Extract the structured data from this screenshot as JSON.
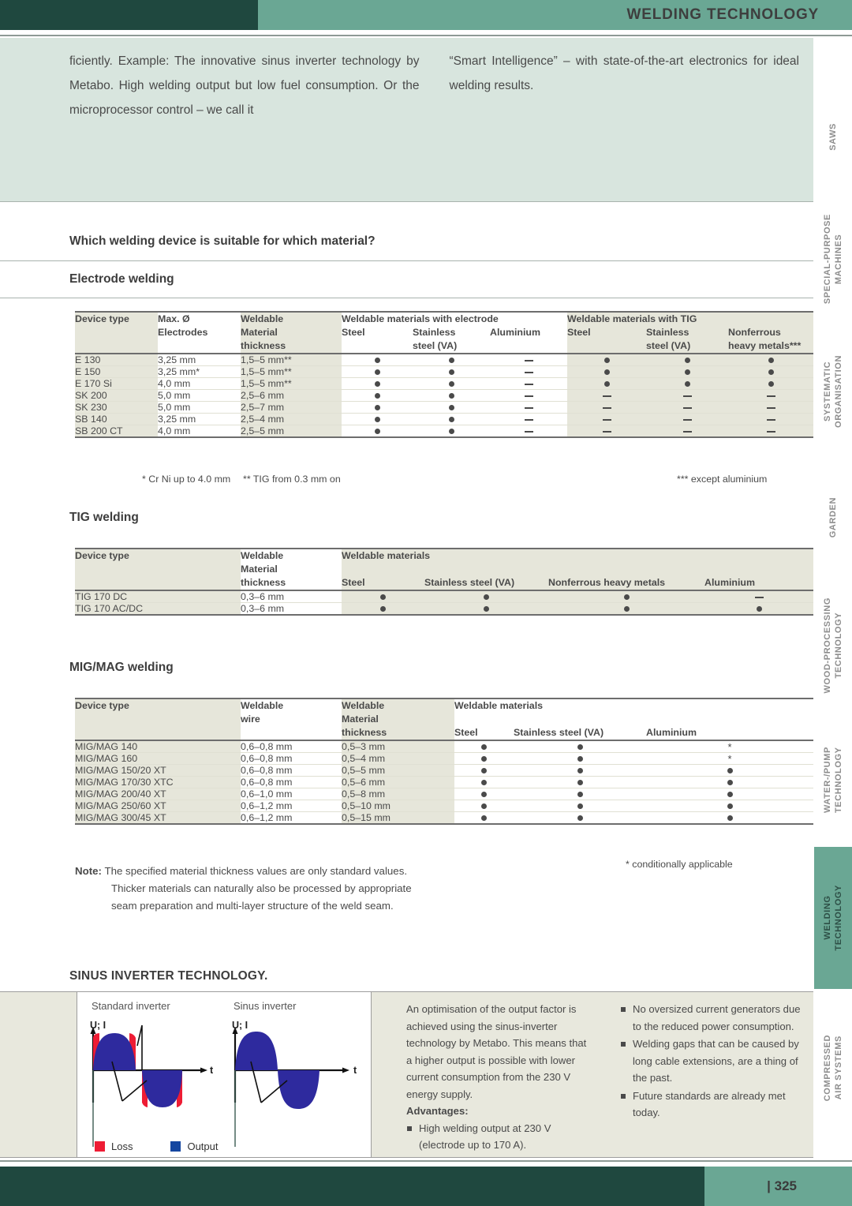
{
  "header": {
    "title": "WELDING TECHNOLOGY"
  },
  "intro": {
    "left": "ficiently. Example: The innovative sinus inverter techno­logy by Metabo. High welding output but low fuel con­sumption. Or the microprocessor control – we call it",
    "right": "“Smart Intelligence” – with state-of-the-art electronics for ideal welding results."
  },
  "question_heading": "Which welding device is suitable for which material?",
  "electrode": {
    "heading": "Electrode welding",
    "headers": {
      "device_type": "Device type",
      "max_dia": [
        "Max. Ø",
        "Electrodes"
      ],
      "thickness": [
        "Weldable",
        "Material",
        "thickness"
      ],
      "group_electrode": "Weldable materials with electrode",
      "group_tig": "Weldable materials  with TIG",
      "sub_electrode": [
        "Steel",
        "Stainless\nsteel (VA)",
        "Aluminium"
      ],
      "sub_tig": [
        "Steel",
        "Stainless\nsteel (VA)",
        "Nonferrous\nheavy metals***"
      ]
    },
    "rows": [
      {
        "device": "E 130",
        "dia": "3,25 mm",
        "thick": "1,5–5 mm**",
        "e": [
          "dot",
          "dot",
          "dash"
        ],
        "t": [
          "dot",
          "dot",
          "dot"
        ]
      },
      {
        "device": "E 150",
        "dia": "3,25 mm*",
        "thick": "1,5–5 mm**",
        "e": [
          "dot",
          "dot",
          "dash"
        ],
        "t": [
          "dot",
          "dot",
          "dot"
        ]
      },
      {
        "device": "E 170 Si",
        "dia": "4,0 mm",
        "thick": "1,5–5 mm**",
        "e": [
          "dot",
          "dot",
          "dash"
        ],
        "t": [
          "dot",
          "dot",
          "dot"
        ]
      },
      {
        "device": "SK 200",
        "dia": "5,0 mm",
        "thick": "2,5–6 mm",
        "e": [
          "dot",
          "dot",
          "dash"
        ],
        "t": [
          "dash",
          "dash",
          "dash"
        ]
      },
      {
        "device": "SK 230",
        "dia": "5,0 mm",
        "thick": "2,5–7 mm",
        "e": [
          "dot",
          "dot",
          "dash"
        ],
        "t": [
          "dash",
          "dash",
          "dash"
        ]
      },
      {
        "device": "SB 140",
        "dia": "3,25 mm",
        "thick": "2,5–4 mm",
        "e": [
          "dot",
          "dot",
          "dash"
        ],
        "t": [
          "dash",
          "dash",
          "dash"
        ]
      },
      {
        "device": "SB 200 CT",
        "dia": "4,0 mm",
        "thick": "2,5–5 mm",
        "e": [
          "dot",
          "dot",
          "dash"
        ],
        "t": [
          "dash",
          "dash",
          "dash"
        ]
      }
    ],
    "footnotes": {
      "one": "* Cr Ni up to 4.0 mm",
      "two": "** TIG from 0.3 mm on",
      "three": "*** except aluminium"
    }
  },
  "tig": {
    "heading": "TIG welding",
    "headers": {
      "device_type": "Device type",
      "thickness": [
        "Weldable",
        "Material",
        "thickness"
      ],
      "group": "Weldable materials",
      "sub": [
        "Steel",
        "Stainless steel (VA)",
        "Nonferrous heavy metals",
        "Aluminium"
      ]
    },
    "rows": [
      {
        "device": "TIG 170 DC",
        "thick": "0,3–6 mm",
        "m": [
          "dot",
          "dot",
          "dot",
          "dash"
        ]
      },
      {
        "device": "TIG 170 AC/DC",
        "thick": "0,3–6 mm",
        "m": [
          "dot",
          "dot",
          "dot",
          "dot"
        ]
      }
    ]
  },
  "migmag": {
    "heading": "MIG/MAG welding",
    "headers": {
      "device_type": "Device type",
      "wire": [
        "Weldable",
        "wire"
      ],
      "thickness": [
        "Weldable",
        "Material",
        "thickness"
      ],
      "group": "Weldable materials",
      "sub": [
        "Steel",
        "Stainless steel (VA)",
        "Aluminium"
      ]
    },
    "rows": [
      {
        "device": "MIG/MAG 140",
        "wire": "0,6–0,8 mm",
        "thick": "0,5–3 mm",
        "m": [
          "dot",
          "dot",
          "ast"
        ]
      },
      {
        "device": "MIG/MAG 160",
        "wire": "0,6–0,8 mm",
        "thick": "0,5–4 mm",
        "m": [
          "dot",
          "dot",
          "ast"
        ]
      },
      {
        "device": "MIG/MAG 150/20 XT",
        "wire": "0,6–0,8 mm",
        "thick": "0,5–5 mm",
        "m": [
          "dot",
          "dot",
          "dot"
        ]
      },
      {
        "device": "MIG/MAG 170/30 XTC",
        "wire": "0,6–0,8 mm",
        "thick": "0,5–6 mm",
        "m": [
          "dot",
          "dot",
          "dot"
        ]
      },
      {
        "device": "MIG/MAG 200/40 XT",
        "wire": "0,6–1,0 mm",
        "thick": "0,5–8 mm",
        "m": [
          "dot",
          "dot",
          "dot"
        ]
      },
      {
        "device": "MIG/MAG 250/60 XT",
        "wire": "0,6–1,2 mm",
        "thick": "0,5–10 mm",
        "m": [
          "dot",
          "dot",
          "dot"
        ]
      },
      {
        "device": "MIG/MAG 300/45 XT",
        "wire": "0,6–1,2 mm",
        "thick": "0,5–15 mm",
        "m": [
          "dot",
          "dot",
          "dot"
        ]
      }
    ],
    "footnote": "* conditionally applicable"
  },
  "note": {
    "label": "Note:",
    "line1": "The specified material thickness values are only standard values.",
    "line2": "Thicker materials can naturally also be processed by appropriate",
    "line3": "seam preparation and multi-layer structure of the weld seam."
  },
  "sinus": {
    "title": "SINUS INVERTER TECHNOLOGY.",
    "diagram": {
      "left_label": "Standard inverter",
      "right_label": "Sinus inverter",
      "y_axis": "U; I",
      "x_axis": "t",
      "legend": [
        {
          "name": "Loss",
          "color": "#ee1c34"
        },
        {
          "name": "Output",
          "color": "#1446a0"
        }
      ]
    },
    "body": "An optimisation of the output factor is achieved using the sinus-inverter technology by Metabo. This means that a higher output is possible with lower current consumption from the 230 V energy supply.",
    "advantages_label": "Advantages:",
    "advantages": [
      "High welding output at 230 V (electrode up to 170 A)."
    ],
    "bullets_right": [
      "No oversized current generators due to the reduced power con­sumption.",
      "Welding gaps that can be caused by long cable extensions, are a thing of the past.",
      "Future standards are already met today."
    ]
  },
  "sidebar": {
    "tabs": [
      {
        "label": "SAWS",
        "active": false
      },
      {
        "label": "SPECIAL-PURPOSE\nMACHINES",
        "active": false
      },
      {
        "label": "SYSTEMATIC\nORGANISATION",
        "active": false
      },
      {
        "label": "GARDEN",
        "active": false
      },
      {
        "label": "WOOD-PROCESSING\nTECHNOLOGY",
        "active": false
      },
      {
        "label": "WATER-/PUMP\nTECHNOLOGY",
        "active": false
      },
      {
        "label": "WELDING\nTECHNOLOGY",
        "active": true
      },
      {
        "label": "COMPRESSED\nAIR SYSTEMS",
        "active": false
      }
    ]
  },
  "footer": {
    "page_number": "| 325"
  },
  "colors": {
    "dark_green": "#1f483f",
    "teal": "#6aa794",
    "pale_green": "#d8e5de",
    "table_shade": "#e6e6da",
    "panel_beige": "#e8e8dd"
  }
}
